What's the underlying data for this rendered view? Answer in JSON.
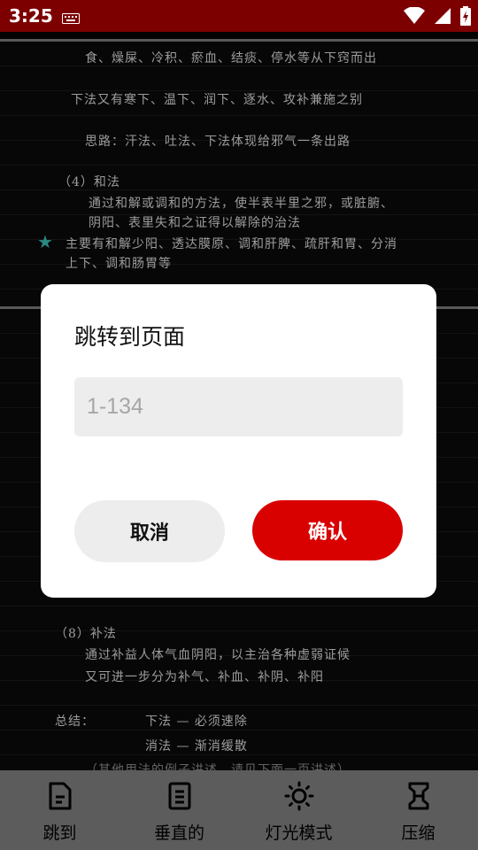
{
  "status_bar": {
    "time": "3:25"
  },
  "document": {
    "page1_lines": [
      "食、燥屎、冷积、瘀血、结痰、停水等从下窍而出",
      "下法又有寒下、温下、润下、逐水、攻补兼施之别",
      "思路：汗法、吐法、下法体现给邪气一条出路",
      "（4）和法",
      "通过和解或调和的方法，使半表半里之邪，或脏腑、",
      "阴阳、表里失和之证得以解除的治法",
      "主要有和解少阳、透达膜原、调和肝脾、疏肝和胃、分消",
      "上下、调和肠胃等"
    ],
    "page2_lines": [
      "（8）补法",
      "通过补益人体气血阴阳，以主治各种虚弱证候",
      "又可进一步分为补气、补血、补阴、补阳",
      "总结：",
      "下法 — 必须速除",
      "消法 — 渐消缓散",
      "（其他用法的例子讲述，请见下面一页讲述）"
    ]
  },
  "dialog": {
    "title": "跳转到页面",
    "input_placeholder": "1-134",
    "input_value": "",
    "cancel_label": "取消",
    "confirm_label": "确认"
  },
  "toolbar": {
    "items": [
      {
        "label": "跳到",
        "icon": "document-jump-icon"
      },
      {
        "label": "垂直的",
        "icon": "vertical-scroll-icon"
      },
      {
        "label": "灯光模式",
        "icon": "sun-icon"
      },
      {
        "label": "压缩",
        "icon": "compress-icon"
      }
    ]
  },
  "colors": {
    "status_bar": "#7d0000",
    "confirm": "#d90000",
    "toolbar": "#5c5c5c"
  }
}
